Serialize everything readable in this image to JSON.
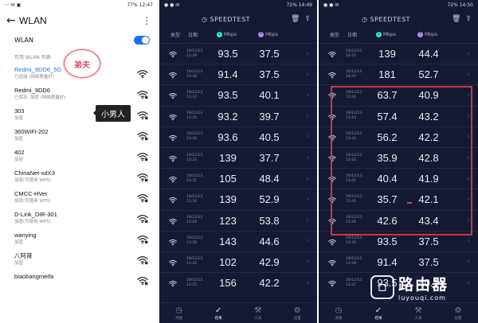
{
  "wlan": {
    "status_time": "12:47",
    "status_left": "··· ✉ ▣",
    "status_battery": "77%",
    "title": "WLAN",
    "toggle_label": "WLAN",
    "section": "可用 WLAN 列表",
    "networks": [
      {
        "name": "Redmi_9DD6_5G",
        "sub": "已连接 (网络质量好)",
        "active": true
      },
      {
        "name": "Redmi_9DD6",
        "sub": "已保存, 加密 (网络质量好)"
      },
      {
        "name": "303",
        "sub": "加密"
      },
      {
        "name": "360WiFi-202",
        "sub": "加密"
      },
      {
        "name": "402",
        "sub": "加密"
      },
      {
        "name": "ChinaNet-xdX3",
        "sub": "加密(可使用 WPS)"
      },
      {
        "name": "CMCC-HVer",
        "sub": "加密(可使用 WPS)"
      },
      {
        "name": "D-Link_DIR-301",
        "sub": "加密(可使用 WPS)"
      },
      {
        "name": "wanying",
        "sub": "加密"
      },
      {
        "name": "八阿哥",
        "sub": "加密"
      },
      {
        "name": "biaobangmeifa",
        "sub": ""
      }
    ],
    "annotation_1": "弟夫",
    "annotation_2": "小男人"
  },
  "speedtest_left": {
    "status_time": "14:49",
    "status_battery": "72%",
    "logo": "SPEEDTEST",
    "col_type": "类型",
    "col_date": "日期",
    "col_down": "Mbps",
    "col_up": "Mbps",
    "rows": [
      {
        "date": "19/12/13",
        "time": "13:39",
        "down": "93.5",
        "up": "37.5"
      },
      {
        "date": "19/12/13",
        "time": "13:38",
        "down": "91.4",
        "up": "37.5"
      },
      {
        "date": "19/12/13",
        "time": "13:37",
        "down": "93.5",
        "up": "40.1"
      },
      {
        "date": "19/12/13",
        "time": "13:35",
        "down": "93.2",
        "up": "39.7"
      },
      {
        "date": "19/12/13",
        "time": "13:34",
        "down": "93.6",
        "up": "40.5"
      },
      {
        "date": "19/12/13",
        "time": "13:33",
        "down": "139",
        "up": "37.7"
      },
      {
        "date": "19/12/13",
        "time": "13:31",
        "down": "105",
        "up": "48.4"
      },
      {
        "date": "19/12/13",
        "time": "13:30",
        "down": "139",
        "up": "52.9"
      },
      {
        "date": "19/12/13",
        "time": "13:29",
        "down": "123",
        "up": "53.8"
      },
      {
        "date": "19/12/13",
        "time": "13:28",
        "down": "143",
        "up": "44.6"
      },
      {
        "date": "19/12/13",
        "time": "13:26",
        "down": "102",
        "up": "42.9"
      },
      {
        "date": "19/12/13",
        "time": "13:25",
        "down": "156",
        "up": "42.2"
      }
    ],
    "nav": [
      "测速",
      "结果",
      "工具",
      "设置"
    ]
  },
  "speedtest_right": {
    "status_time": "14:50",
    "status_battery": "72%",
    "logo": "SPEEDTEST",
    "col_type": "类型",
    "col_date": "日期",
    "col_down": "Mbps",
    "col_up": "Mbps",
    "rows": [
      {
        "date": "19/12/13",
        "time": "14:47",
        "down": "139",
        "up": "44.4"
      },
      {
        "date": "19/12/13",
        "time": "14:47",
        "down": "181",
        "up": "52.7"
      },
      {
        "date": "19/12/13",
        "time": "13:44",
        "down": "63.7",
        "up": "40.9"
      },
      {
        "date": "19/12/13",
        "time": "13:43",
        "down": "57.4",
        "up": "43.2"
      },
      {
        "date": "19/12/13",
        "time": "13:43",
        "down": "56.2",
        "up": "42.2"
      },
      {
        "date": "19/12/13",
        "time": "13:42",
        "down": "35.9",
        "up": "42.8"
      },
      {
        "date": "19/12/13",
        "time": "13:41",
        "down": "40.4",
        "up": "41.9"
      },
      {
        "date": "19/12/13",
        "time": "13:41",
        "down": "35.7",
        "up": "42.1"
      },
      {
        "date": "19/12/13",
        "time": "13:40",
        "down": "42.6",
        "up": "43.4"
      },
      {
        "date": "19/12/13",
        "time": "13:39",
        "down": "93.5",
        "up": "37.5"
      },
      {
        "date": "19/12/13",
        "time": "13:38",
        "down": "91.4",
        "up": "37.5"
      },
      {
        "date": "19/12/13",
        "time": "13:37",
        "down": "93.5",
        "up": "40.1"
      }
    ],
    "nav": [
      "测速",
      "结果",
      "工具",
      "设置"
    ],
    "brand_cn": "路由器",
    "brand_en": "luyouqi.com"
  },
  "colors": {
    "accent_blue": "#1a73e8",
    "speedtest_bg": "#141a34",
    "download_cyan": "#2ee6d6",
    "upload_purple": "#b18cf2",
    "highlight_red": "#d4343d"
  },
  "icons": {
    "wifi": "wifi-icon",
    "back": "back-arrow-icon",
    "more": "more-vertical-icon",
    "trash": "trash-icon",
    "share": "share-icon",
    "chevron": "chevron-right-icon"
  }
}
